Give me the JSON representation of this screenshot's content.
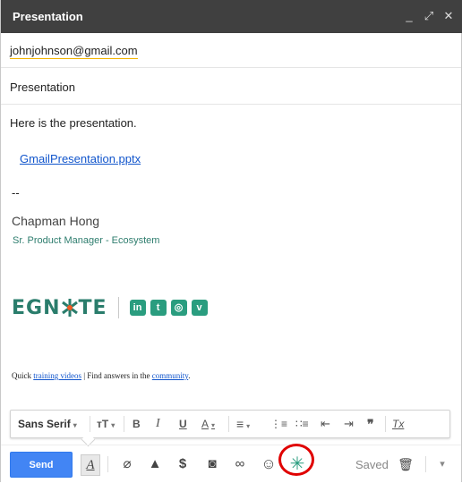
{
  "window": {
    "title": "Presentation",
    "minimize_glyph": "_",
    "expand_glyph": "⤢",
    "close_glyph": "✕"
  },
  "compose": {
    "to_value": "johnjohnson@gmail.com",
    "subject_value": "Presentation",
    "body": {
      "line1": "Here is the presentation.",
      "attachment_link": "GmailPresentation.pptx",
      "separator": "--",
      "signature_name": "Chapman Hong",
      "signature_role": "Sr. Product Manager - Ecosystem",
      "brand_left": "EGN",
      "brand_right": "TE",
      "social": [
        "in",
        "t",
        "◎",
        "v"
      ],
      "footer_prefix": "Quick ",
      "footer_link1": "training videos",
      "footer_mid": " | Find answers in the ",
      "footer_link2": "community",
      "footer_end": "."
    }
  },
  "format_toolbar": {
    "font": "Sans Serif",
    "size_glyph": "тT",
    "bold": "B",
    "italic": "I",
    "underline": "U",
    "text_color": "A",
    "align_glyph": "≡",
    "numbered_glyph": "⋮≡",
    "bulleted_glyph": "∷≡",
    "indent_less_glyph": "⇤",
    "indent_more_glyph": "⇥",
    "quote_glyph": "❞",
    "clear_glyph": "Tx"
  },
  "bottom_bar": {
    "send_label": "Send",
    "format_glyph": "A",
    "attach_glyph": "⌀",
    "drive_glyph": "▲",
    "money_glyph": "$",
    "photo_glyph": "◙",
    "link_glyph": "∞",
    "emoji_glyph": "☺",
    "egnyte_glyph": "✳",
    "saved_label": "Saved",
    "trash_glyph": "🗑",
    "more_glyph": "▾"
  },
  "colors": {
    "titlebar": "#404040",
    "send": "#4285f4",
    "brand": "#2a7d6c",
    "highlight_circle": "#e00000"
  }
}
